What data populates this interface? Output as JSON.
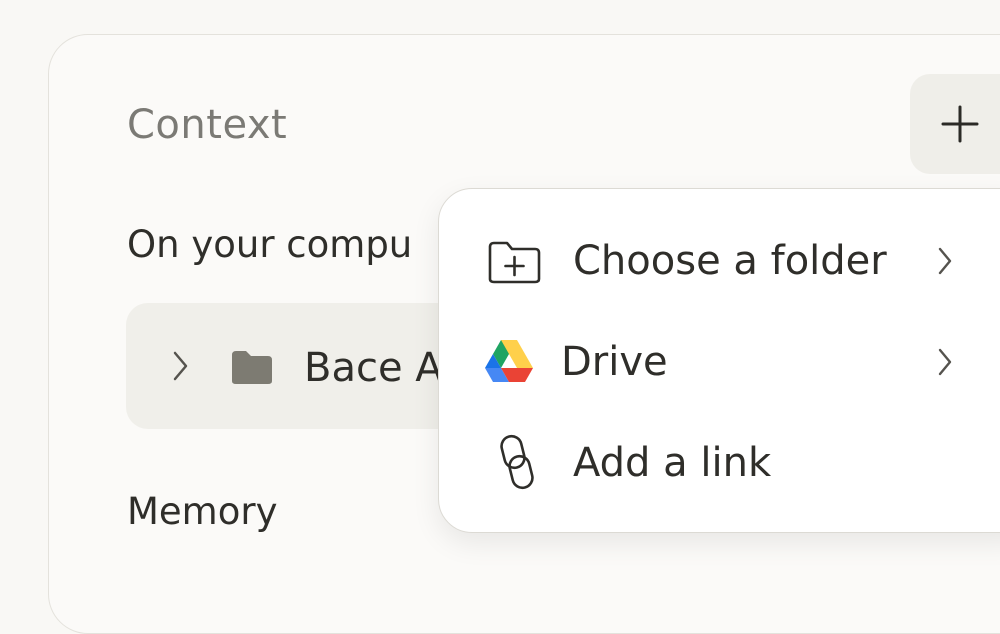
{
  "panel": {
    "title": "Context",
    "add_button_label": "+"
  },
  "on_computer": {
    "title": "On your compu",
    "folder_name": "Bace A"
  },
  "memory": {
    "title": "Memory"
  },
  "menu": {
    "items": [
      {
        "label": "Choose a folder",
        "icon": "folder-plus-icon",
        "has_submenu": true
      },
      {
        "label": "Drive",
        "icon": "google-drive-icon",
        "has_submenu": true
      },
      {
        "label": "Add a link",
        "icon": "link-icon",
        "has_submenu": false
      }
    ]
  },
  "colors": {
    "background": "#f9f8f5",
    "panel_bg": "#fbfaf8",
    "muted_text": "#7b7a75",
    "text": "#2f2e2a",
    "row_bg": "#f0efea",
    "button_bg": "#efeee9",
    "menu_bg": "#ffffff",
    "drive_green": "#1fa463",
    "drive_yellow": "#ffd04b",
    "drive_blue": "#4688f4",
    "drive_red": "#ea4335"
  }
}
